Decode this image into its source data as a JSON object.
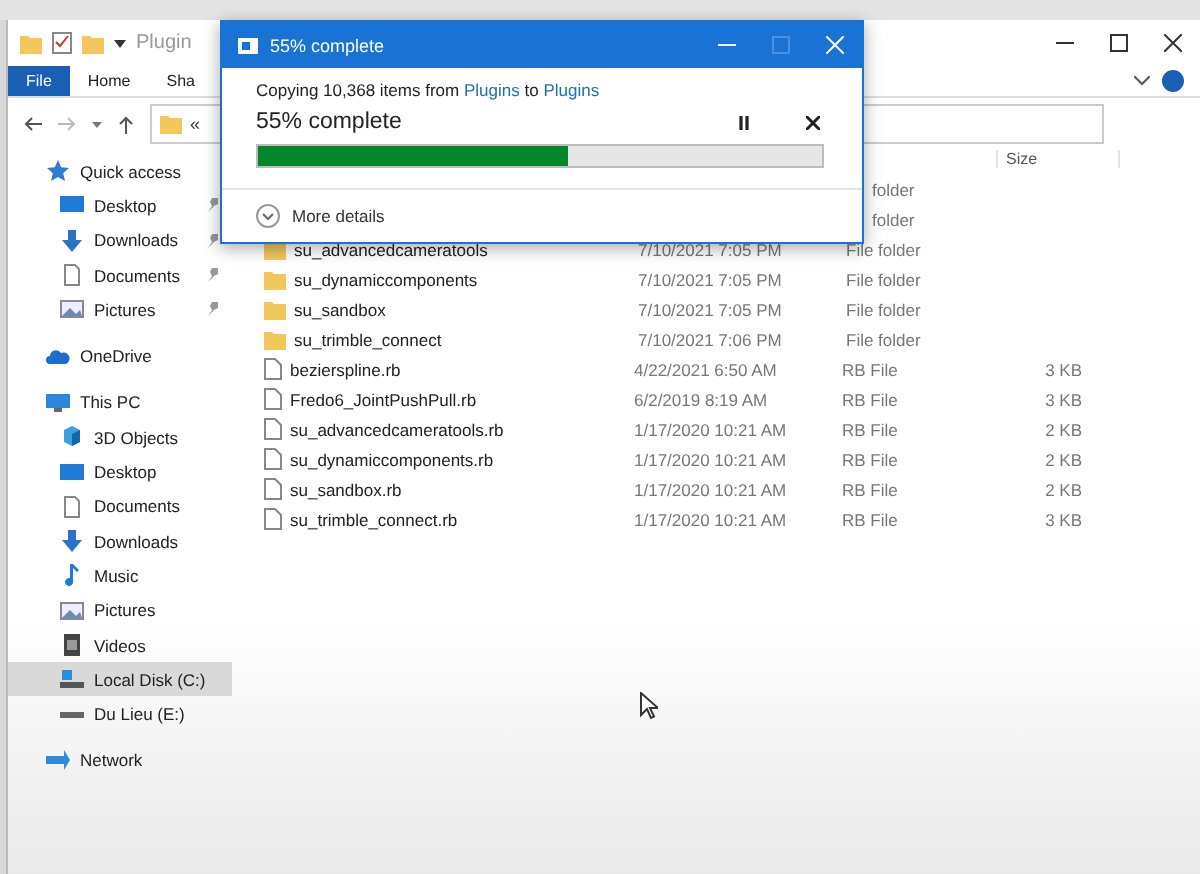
{
  "explorer": {
    "title": "Plugin",
    "ribbon_tabs": [
      {
        "label": "File",
        "selected": true
      },
      {
        "label": "Home",
        "selected": false
      },
      {
        "label": "Sha",
        "selected": false
      }
    ],
    "address": "«",
    "columns": [
      "Size"
    ],
    "sidebar": [
      {
        "label": "Quick access",
        "kind": "star",
        "level_in": false,
        "pinned": false,
        "selected": false
      },
      {
        "label": "Desktop",
        "kind": "desktop",
        "level_in": true,
        "pinned": true,
        "selected": false
      },
      {
        "label": "Downloads",
        "kind": "download",
        "level_in": true,
        "pinned": true,
        "selected": false
      },
      {
        "label": "Documents",
        "kind": "document",
        "level_in": true,
        "pinned": true,
        "selected": false
      },
      {
        "label": "Pictures",
        "kind": "pictures",
        "level_in": true,
        "pinned": true,
        "selected": false
      },
      {
        "label": "OneDrive",
        "kind": "cloud",
        "level_in": false,
        "pinned": false,
        "selected": false
      },
      {
        "label": "This PC",
        "kind": "pc",
        "level_in": false,
        "pinned": false,
        "selected": false
      },
      {
        "label": "3D Objects",
        "kind": "cube",
        "level_in": true,
        "pinned": false,
        "selected": false
      },
      {
        "label": "Desktop",
        "kind": "desktop",
        "level_in": true,
        "pinned": false,
        "selected": false
      },
      {
        "label": "Documents",
        "kind": "document",
        "level_in": true,
        "pinned": false,
        "selected": false
      },
      {
        "label": "Downloads",
        "kind": "download",
        "level_in": true,
        "pinned": false,
        "selected": false
      },
      {
        "label": "Music",
        "kind": "music",
        "level_in": true,
        "pinned": false,
        "selected": false
      },
      {
        "label": "Pictures",
        "kind": "pictures",
        "level_in": true,
        "pinned": false,
        "selected": false
      },
      {
        "label": "Videos",
        "kind": "video",
        "level_in": true,
        "pinned": false,
        "selected": false
      },
      {
        "label": "Local Disk (C:)",
        "kind": "disk",
        "level_in": true,
        "pinned": false,
        "selected": true
      },
      {
        "label": "Du Lieu (E:)",
        "kind": "drive",
        "level_in": true,
        "pinned": false,
        "selected": false
      },
      {
        "label": "Network",
        "kind": "network",
        "level_in": false,
        "pinned": false,
        "selected": false
      }
    ],
    "files": [
      {
        "type": "folder",
        "kind": "hidden"
      },
      {
        "type": "folder",
        "kind": "hidden"
      },
      {
        "name": "su_advancedcameratools",
        "date": "7/10/2021 7:05 PM",
        "type": "File folder",
        "kind": "folder"
      },
      {
        "name": "su_dynamiccomponents",
        "date": "7/10/2021 7:05 PM",
        "type": "File folder",
        "kind": "folder"
      },
      {
        "name": "su_sandbox",
        "date": "7/10/2021 7:05 PM",
        "type": "File folder",
        "kind": "folder"
      },
      {
        "name": "su_trimble_connect",
        "date": "7/10/2021 7:06 PM",
        "type": "File folder",
        "kind": "folder"
      },
      {
        "name": "bezierspline.rb",
        "date": "4/22/2021 6:50 AM",
        "type": "RB File",
        "size": "3 KB",
        "kind": "file"
      },
      {
        "name": "Fredo6_JointPushPull.rb",
        "date": "6/2/2019 8:19 AM",
        "type": "RB File",
        "size": "3 KB",
        "kind": "file"
      },
      {
        "name": "su_advancedcameratools.rb",
        "date": "1/17/2020 10:21 AM",
        "type": "RB File",
        "size": "2 KB",
        "kind": "file"
      },
      {
        "name": "su_dynamiccomponents.rb",
        "date": "1/17/2020 10:21 AM",
        "type": "RB File",
        "size": "2 KB",
        "kind": "file"
      },
      {
        "name": "su_sandbox.rb",
        "date": "1/17/2020 10:21 AM",
        "type": "RB File",
        "size": "2 KB",
        "kind": "file"
      },
      {
        "name": "su_trimble_connect.rb",
        "date": "1/17/2020 10:21 AM",
        "type": "RB File",
        "size": "3 KB",
        "kind": "file"
      }
    ]
  },
  "dialog": {
    "title": "55% complete",
    "copying": "Copying 10,368 items from",
    "source": "Plugins",
    "to": "to",
    "destination": "Plugins",
    "status": "55% complete",
    "level": 0.55,
    "more": "More details"
  }
}
